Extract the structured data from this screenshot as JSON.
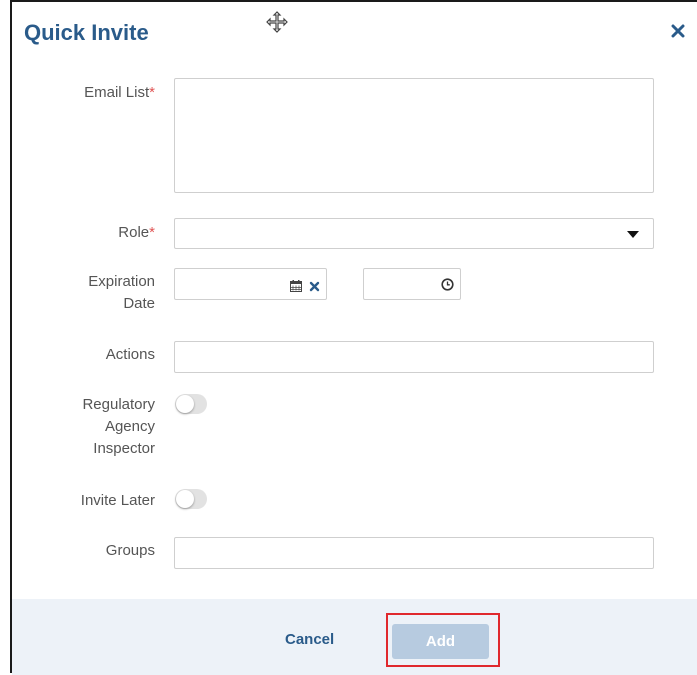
{
  "dialog": {
    "title": "Quick Invite",
    "close_icon": "close-icon",
    "move_icon": "move-icon"
  },
  "form": {
    "email_list": {
      "label": "Email List",
      "required_mark": "*",
      "value": ""
    },
    "role": {
      "label": "Role",
      "required_mark": "*",
      "value": ""
    },
    "expiration_date": {
      "label": "Expiration\nDate",
      "date_value": "",
      "time_value": ""
    },
    "actions": {
      "label": "Actions",
      "value": ""
    },
    "regulatory": {
      "label": "Regulatory\nAgency\nInspector",
      "toggle_on": false
    },
    "invite_later": {
      "label": "Invite Later",
      "toggle_on": false
    },
    "groups": {
      "label": "Groups",
      "value": ""
    }
  },
  "footer": {
    "cancel_label": "Cancel",
    "add_label": "Add"
  },
  "colors": {
    "title": "#2a5b8a",
    "required": "#e05252",
    "add_button": "#b7cbe0",
    "highlight": "#e0282d",
    "footer_bg": "#edf2f8"
  }
}
